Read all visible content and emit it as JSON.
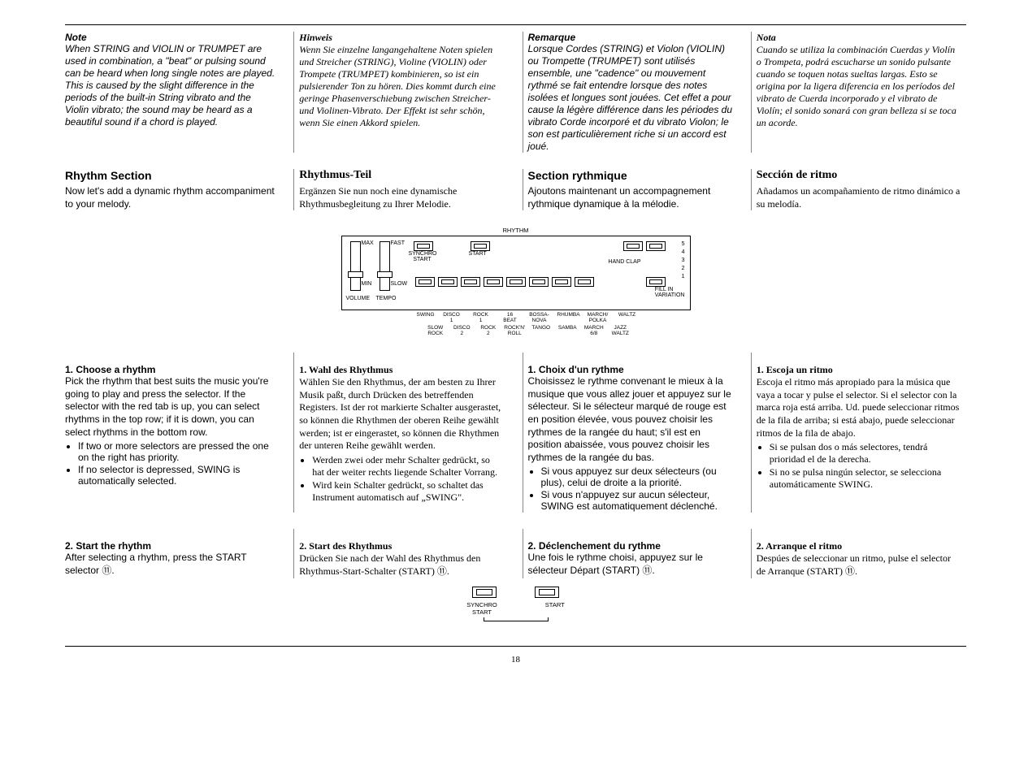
{
  "page_number": "18",
  "topblock": {
    "en": {
      "label": "Note",
      "body": "When STRING and VIOLIN or TRUMPET are used in combination, a \"beat\" or pulsing sound can be heard when long single notes are played. This is caused by the slight difference in the periods of the built-in String vibrato and the Violin vibrato; the sound may be heard as a beautiful sound if a chord is played."
    },
    "de": {
      "label": "Hinweis",
      "body": "Wenn Sie einzelne langangehaltene Noten spielen und Streicher (STRING), Violine (VIOLIN) oder Trompete (TRUMPET) kombinieren, so ist ein pulsierender Ton zu hören. Dies kommt durch eine geringe Phasenverschiebung zwischen Streicher- und Violinen-Vibrato. Der Effekt ist sehr schön, wenn Sie einen Akkord spielen."
    },
    "fr": {
      "label": "Remarque",
      "body": "Lorsque Cordes (STRING) et Violon (VIOLIN) ou Trompette (TRUMPET) sont utilisés ensemble, une \"cadence\" ou mouvement rythmé se fait entendre lorsque des notes isolées et longues sont jouées. Cet effet a pour cause la légère différence dans les périodes du vibrato Corde incorporé et du vibrato Violon; le son est particulièrement riche si un accord est joué."
    },
    "es": {
      "label": "Nota",
      "body": "Cuando se utiliza la combinación Cuerdas y Violín o Trompeta, podrá escucharse un sonido pulsante cuando se toquen notas sueltas largas. Esto se origina por la ligera diferencia en los períodos del vibrato de Cuerda incorporado y el vibrato de Violín; el sonido sonará con gran belleza si se toca un acorde."
    }
  },
  "rhythm_head": {
    "en": {
      "h": "Rhythm Section",
      "b": "Now let's add a dynamic rhythm accompaniment to your melody."
    },
    "de": {
      "h": "Rhythmus-Teil",
      "b": "Ergänzen Sie nun noch eine dynamische Rhythmusbegleitung zu Ihrer Melodie."
    },
    "fr": {
      "h": "Section rythmique",
      "b": "Ajoutons maintenant un accompagnement rythmique dynamique à la mélodie."
    },
    "es": {
      "h": "Sección de ritmo",
      "b": "Añadamos un acompañamiento de ritmo dinámico a su melodía."
    }
  },
  "diagram1": {
    "title": "RHYTHM",
    "max": "MAX",
    "min": "MIN",
    "fast": "FAST",
    "slow": "SLOW",
    "volume": "VOLUME",
    "tempo": "TEMPO",
    "synchro_start": "SYNCHRO\nSTART",
    "start": "START",
    "hand_clap": "HAND CLAP",
    "fillin": "FILL IN\nVARIATION",
    "top_row": [
      "DISCO\n1",
      "ROCK\n1",
      "16\nBEAT",
      "BOSSA-\nNOVA",
      "RHUMBA",
      "MARCH/\nPOLKA",
      "WALTZ"
    ],
    "pre_top": "SWING",
    "bot_row": [
      "SLOW\nROCK",
      "DISCO\n2",
      "ROCK\n2",
      "ROCK'N'\nROLL",
      "TANGO",
      "SAMBA",
      "MARCH\n6/8",
      "JAZZ\nWALTZ"
    ],
    "scale": [
      "5",
      "4",
      "3",
      "2",
      "1"
    ]
  },
  "step1": {
    "en": {
      "h": "1. Choose a rhythm",
      "b": "Pick the rhythm that best suits the music you're going to play and press the selector. If the selector with the red tab is up, you can select rhythms in the top row; if it is down, you can select rhythms in the bottom row.",
      "l1": "If two or more selectors are pressed the one on the right has priority.",
      "l2": "If no selector is depressed, SWING is automatically selected."
    },
    "de": {
      "h": "1. Wahl des Rhythmus",
      "b": "Wählen Sie den Rhythmus, der am besten zu Ihrer Musik paßt, durch Drücken des betreffenden Registers. Ist der rot markierte Schalter ausgerastet, so können die Rhythmen der oberen Reihe gewählt werden; ist er eingerastet, so können die Rhythmen der unteren Reihe gewählt werden.",
      "l1": "Werden zwei oder mehr Schalter gedrückt, so hat der weiter rechts liegende Schalter Vorrang.",
      "l2": "Wird kein Schalter gedrückt, so schaltet das Instrument automatisch auf „SWING\"."
    },
    "fr": {
      "h": "1. Choix d'un rythme",
      "b": "Choisissez le rythme convenant le mieux à la musique que vous allez jouer et appuyez sur le sélecteur. Si le sélecteur marqué de rouge est en position élevée, vous pouvez choisir les rythmes de la rangée du haut; s'il est en position abaissée, vous pouvez choisir les rythmes de la rangée du bas.",
      "l1": "Si vous appuyez sur deux sélecteurs (ou plus), celui de droite a la priorité.",
      "l2": "Si vous n'appuyez sur aucun sélecteur, SWING est automatiquement déclenché."
    },
    "es": {
      "h": "1. Escoja un ritmo",
      "b": "Escoja el ritmo más apropiado para la música que vaya a tocar y pulse el selector. Si el selector con la marca roja está arriba. Ud. puede seleccionar ritmos de la fila de arriba; si está abajo, puede seleccionar ritmos de la fila de abajo.",
      "l1": "Si se pulsan dos o más selectores, tendrá prioridad el de la derecha.",
      "l2": "Si no se pulsa ningún selector, se selecciona automáticamente SWING."
    }
  },
  "step2": {
    "en": {
      "h": "2. Start the rhythm",
      "b": "After selecting a rhythm, press the START selector ⑪."
    },
    "de": {
      "h": "2. Start des Rhythmus",
      "b": "Drücken Sie nach der Wahl des Rhythmus den Rhythmus-Start-Schalter (START) ⑪."
    },
    "fr": {
      "h": "2. Déclenchement du rythme",
      "b": "Une fois le rythme choisi, appuyez sur le sélecteur Départ (START) ⑪."
    },
    "es": {
      "h": "2. Arranque el ritmo",
      "b": "Despúes de seleccionar un ritmo, pulse el selector de Arranque (START) ⑪."
    }
  },
  "diagram2": {
    "synchro": "SYNCHRO\nSTART",
    "start": "START"
  }
}
